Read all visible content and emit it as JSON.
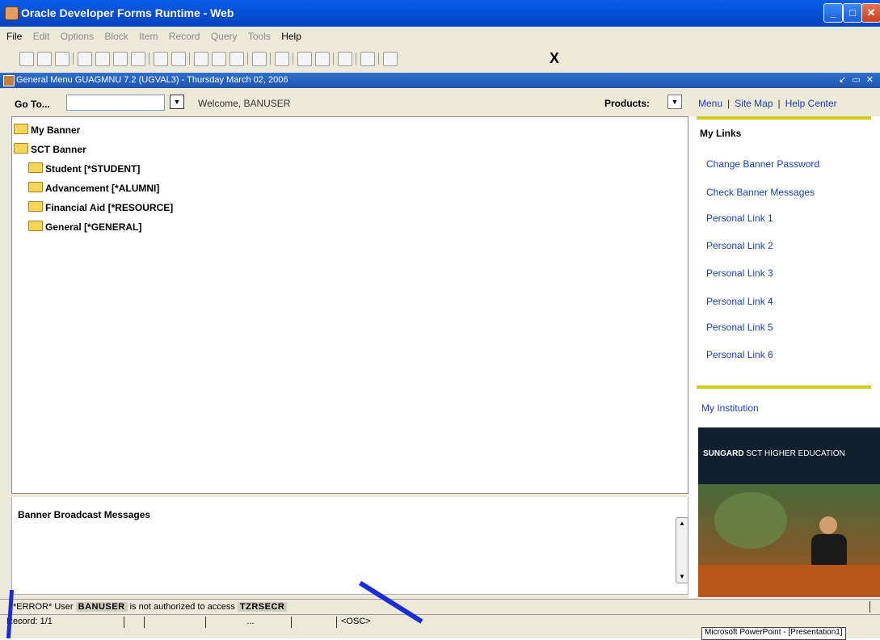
{
  "window": {
    "title": "Oracle Developer Forms Runtime - Web"
  },
  "menubar": {
    "items": [
      "File",
      "Edit",
      "Options",
      "Block",
      "Item",
      "Record",
      "Query",
      "Tools",
      "Help"
    ],
    "disabled": [
      false,
      true,
      true,
      true,
      true,
      true,
      true,
      true,
      false
    ]
  },
  "inner_window": {
    "title": "General Menu  GUAGMNU  7.2  (UGVAL3) - Thursday March 02, 2006"
  },
  "toolbar": {
    "exit_label": "X"
  },
  "header": {
    "goto_label": "Go To...",
    "goto_value": "",
    "welcome": "Welcome,  BANUSER",
    "products_label": "Products:",
    "links": [
      "Menu",
      "Site Map",
      "Help Center"
    ]
  },
  "tree": {
    "my_banner": "My Banner",
    "sct_banner": "SCT Banner",
    "children": [
      "Student [*STUDENT]",
      "Advancement [*ALUMNI]",
      "Financial Aid [*RESOURCE]",
      "General [*GENERAL]"
    ]
  },
  "broadcast": {
    "label": "Banner Broadcast Messages"
  },
  "sidebar": {
    "my_links_label": "My Links",
    "links": [
      "Change Banner Password",
      "Check Banner Messages",
      "Personal Link 1",
      "Personal Link 2",
      "Personal Link 3",
      "Personal Link 4",
      "Personal Link 5",
      "Personal Link 6"
    ],
    "my_institution": "My Institution",
    "ad_brand": "SUNGARD",
    "ad_text": "SCT HIGHER EDUCATION"
  },
  "status": {
    "err_prefix": "*ERROR* User",
    "err_user": "BANUSER",
    "err_mid": "is not authorized to access",
    "err_form": "TZRSECR",
    "record": "Record: 1/1",
    "dots": "...",
    "osc": "<OSC>"
  },
  "taskbar": {
    "ppt": "Microsoft PowerPoint - [Presentation1]"
  },
  "colors": {
    "title_blue": "#0550d8",
    "link_blue": "#1a3fb0",
    "accent_yellow": "#cfcc1a",
    "selection": "#0a24c8"
  }
}
